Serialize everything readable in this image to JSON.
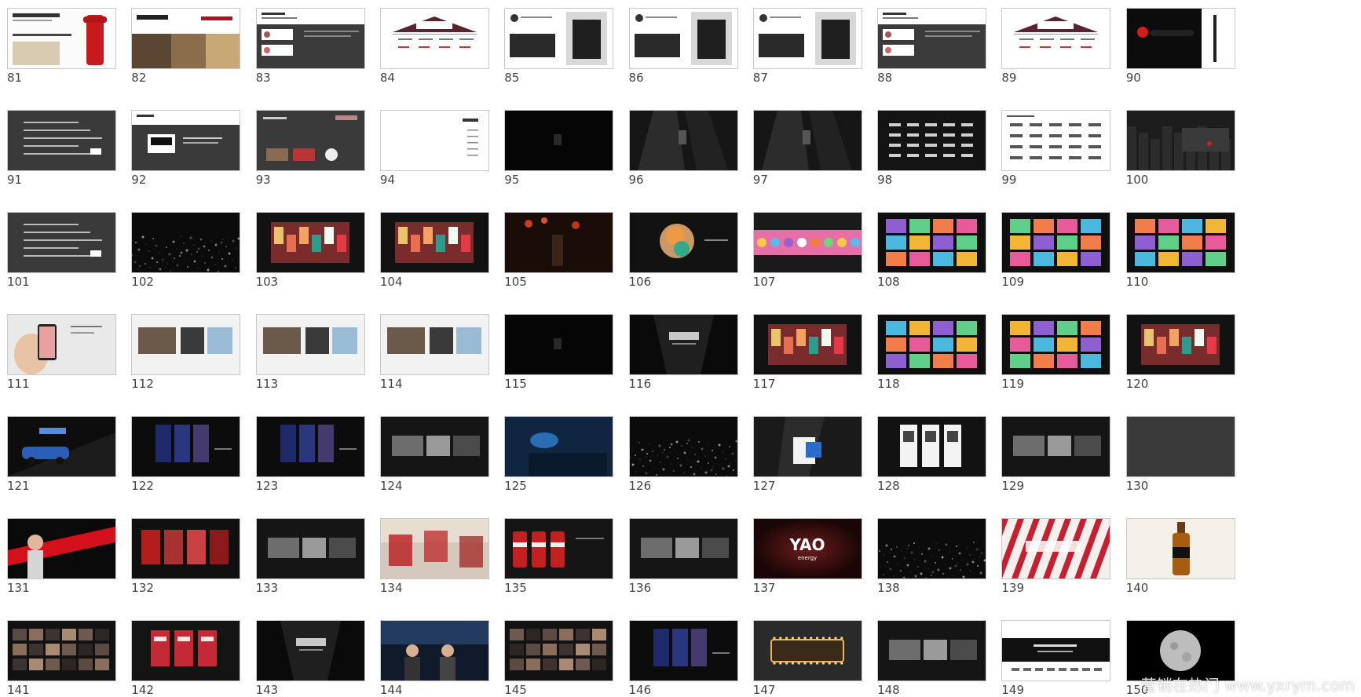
{
  "slides": [
    {
      "number": "81",
      "theme": "letter-red"
    },
    {
      "number": "82",
      "theme": "bookstore"
    },
    {
      "number": "83",
      "theme": "white-dark-cards"
    },
    {
      "number": "84",
      "theme": "house-diagram"
    },
    {
      "number": "85",
      "theme": "portrait-collage"
    },
    {
      "number": "86",
      "theme": "portrait-collage"
    },
    {
      "number": "87",
      "theme": "portrait-collage"
    },
    {
      "number": "88",
      "theme": "white-dark-cards"
    },
    {
      "number": "89",
      "theme": "house-diagram"
    },
    {
      "number": "90",
      "theme": "dark-product-red"
    },
    {
      "number": "91",
      "theme": "dark-text"
    },
    {
      "number": "92",
      "theme": "logo-dark"
    },
    {
      "number": "93",
      "theme": "dark-text-images"
    },
    {
      "number": "94",
      "theme": "white-toc"
    },
    {
      "number": "95",
      "theme": "black-minimal"
    },
    {
      "number": "96",
      "theme": "dark-corridor"
    },
    {
      "number": "97",
      "theme": "dark-corridor"
    },
    {
      "number": "98",
      "theme": "dark-logo-grid"
    },
    {
      "number": "99",
      "theme": "white-logo-grid"
    },
    {
      "number": "100",
      "theme": "dark-city"
    },
    {
      "number": "101",
      "theme": "dark-text"
    },
    {
      "number": "102",
      "theme": "dark-particles"
    },
    {
      "number": "103",
      "theme": "dark-colorful"
    },
    {
      "number": "104",
      "theme": "dark-colorful"
    },
    {
      "number": "105",
      "theme": "dark-street"
    },
    {
      "number": "106",
      "theme": "dark-colorful-center"
    },
    {
      "number": "107",
      "theme": "colorful-banner"
    },
    {
      "number": "108",
      "theme": "colorful-grid"
    },
    {
      "number": "109",
      "theme": "colorful-grid"
    },
    {
      "number": "110",
      "theme": "colorful-grid"
    },
    {
      "number": "111",
      "theme": "light-phone"
    },
    {
      "number": "112",
      "theme": "light-photos"
    },
    {
      "number": "113",
      "theme": "light-photos"
    },
    {
      "number": "114",
      "theme": "light-photos"
    },
    {
      "number": "115",
      "theme": "black-minimal"
    },
    {
      "number": "116",
      "theme": "dark-stage"
    },
    {
      "number": "117",
      "theme": "dark-colorful"
    },
    {
      "number": "118",
      "theme": "colorful-grid"
    },
    {
      "number": "119",
      "theme": "colorful-grid"
    },
    {
      "number": "120",
      "theme": "dark-colorful"
    },
    {
      "number": "121",
      "theme": "dark-car"
    },
    {
      "number": "122",
      "theme": "dark-posters"
    },
    {
      "number": "123",
      "theme": "dark-posters"
    },
    {
      "number": "124",
      "theme": "dark-photos"
    },
    {
      "number": "125",
      "theme": "dark-blue"
    },
    {
      "number": "126",
      "theme": "dark-particles"
    },
    {
      "number": "127",
      "theme": "dark-cup"
    },
    {
      "number": "128",
      "theme": "dark-cards-white"
    },
    {
      "number": "129",
      "theme": "dark-photos"
    },
    {
      "number": "130",
      "theme": "gray-blank"
    },
    {
      "number": "131",
      "theme": "red-performer"
    },
    {
      "number": "132",
      "theme": "dark-red-store"
    },
    {
      "number": "133",
      "theme": "dark-photos"
    },
    {
      "number": "134",
      "theme": "red-blur"
    },
    {
      "number": "135",
      "theme": "dark-cans"
    },
    {
      "number": "136",
      "theme": "dark-photos"
    },
    {
      "number": "137",
      "theme": "yao-energy"
    },
    {
      "number": "138",
      "theme": "dark-particles"
    },
    {
      "number": "139",
      "theme": "red-stripes"
    },
    {
      "number": "140",
      "theme": "bottle"
    },
    {
      "number": "141",
      "theme": "dark-photo-grid"
    },
    {
      "number": "142",
      "theme": "dark-red-books"
    },
    {
      "number": "143",
      "theme": "dark-stage"
    },
    {
      "number": "144",
      "theme": "blue-band"
    },
    {
      "number": "145",
      "theme": "dark-photo-grid"
    },
    {
      "number": "146",
      "theme": "dark-posters"
    },
    {
      "number": "147",
      "theme": "marquee"
    },
    {
      "number": "148",
      "theme": "dark-photos"
    },
    {
      "number": "149",
      "theme": "white-black-band"
    },
    {
      "number": "150",
      "theme": "moon"
    }
  ],
  "watermark": "营销在热门 www.yxrym.com",
  "yao_text": "YAO",
  "yao_sub": "energy"
}
